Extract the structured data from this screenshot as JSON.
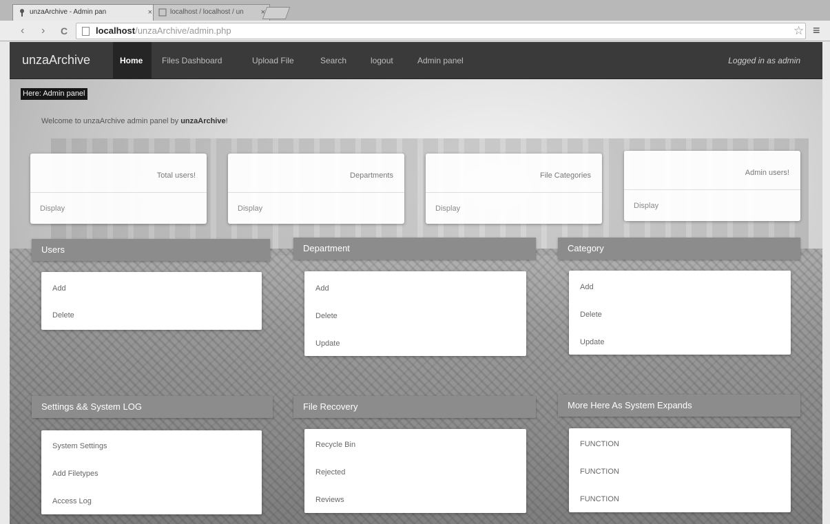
{
  "browser": {
    "tabs": [
      {
        "title": "unzaArchive - Admin pan",
        "close": "×"
      },
      {
        "title": "localhost / localhost / un",
        "close": "×"
      }
    ],
    "nav": {
      "back": "‹",
      "forward": "›",
      "reload": "C"
    },
    "url": {
      "host": "localhost",
      "path": "/unzaArchive/admin.php"
    },
    "star": "☆",
    "menu": "≡"
  },
  "navbar": {
    "brand": "unzaArchive",
    "items": [
      {
        "label": "Home",
        "active": true
      },
      {
        "label": "Files Dashboard"
      },
      {
        "label": "Upload File"
      },
      {
        "label": "Search"
      },
      {
        "label": "logout"
      },
      {
        "label": "Admin panel"
      }
    ],
    "logged_in": "Logged in as admin"
  },
  "breadcrumb": "Here: Admin panel",
  "welcome": {
    "text": "Welcome to unzaArchive admin panel by ",
    "bold": "unzaArchive",
    "end": "!"
  },
  "stat_cards": [
    {
      "title": "Total users!",
      "footer": "Display"
    },
    {
      "title": "Departments",
      "footer": "Display"
    },
    {
      "title": "File Categories",
      "footer": "Display"
    },
    {
      "title": "Admin users!",
      "footer": "Display"
    }
  ],
  "panels": [
    {
      "title": "Users",
      "links": [
        "Add",
        "Delete"
      ]
    },
    {
      "title": "Department",
      "links": [
        "Add",
        "Delete",
        "Update"
      ]
    },
    {
      "title": "Category",
      "links": [
        "Add",
        "Delete",
        "Update"
      ]
    },
    {
      "title": "Settings && System LOG",
      "links": [
        "System Settings",
        "Add Filetypes",
        "Access Log"
      ]
    },
    {
      "title": "File Recovery",
      "links": [
        "Recycle Bin",
        "Rejected",
        "Reviews"
      ]
    },
    {
      "title": "More Here As System Expands",
      "links": [
        "FUNCTION",
        "FUNCTION",
        "FUNCTION"
      ]
    }
  ]
}
